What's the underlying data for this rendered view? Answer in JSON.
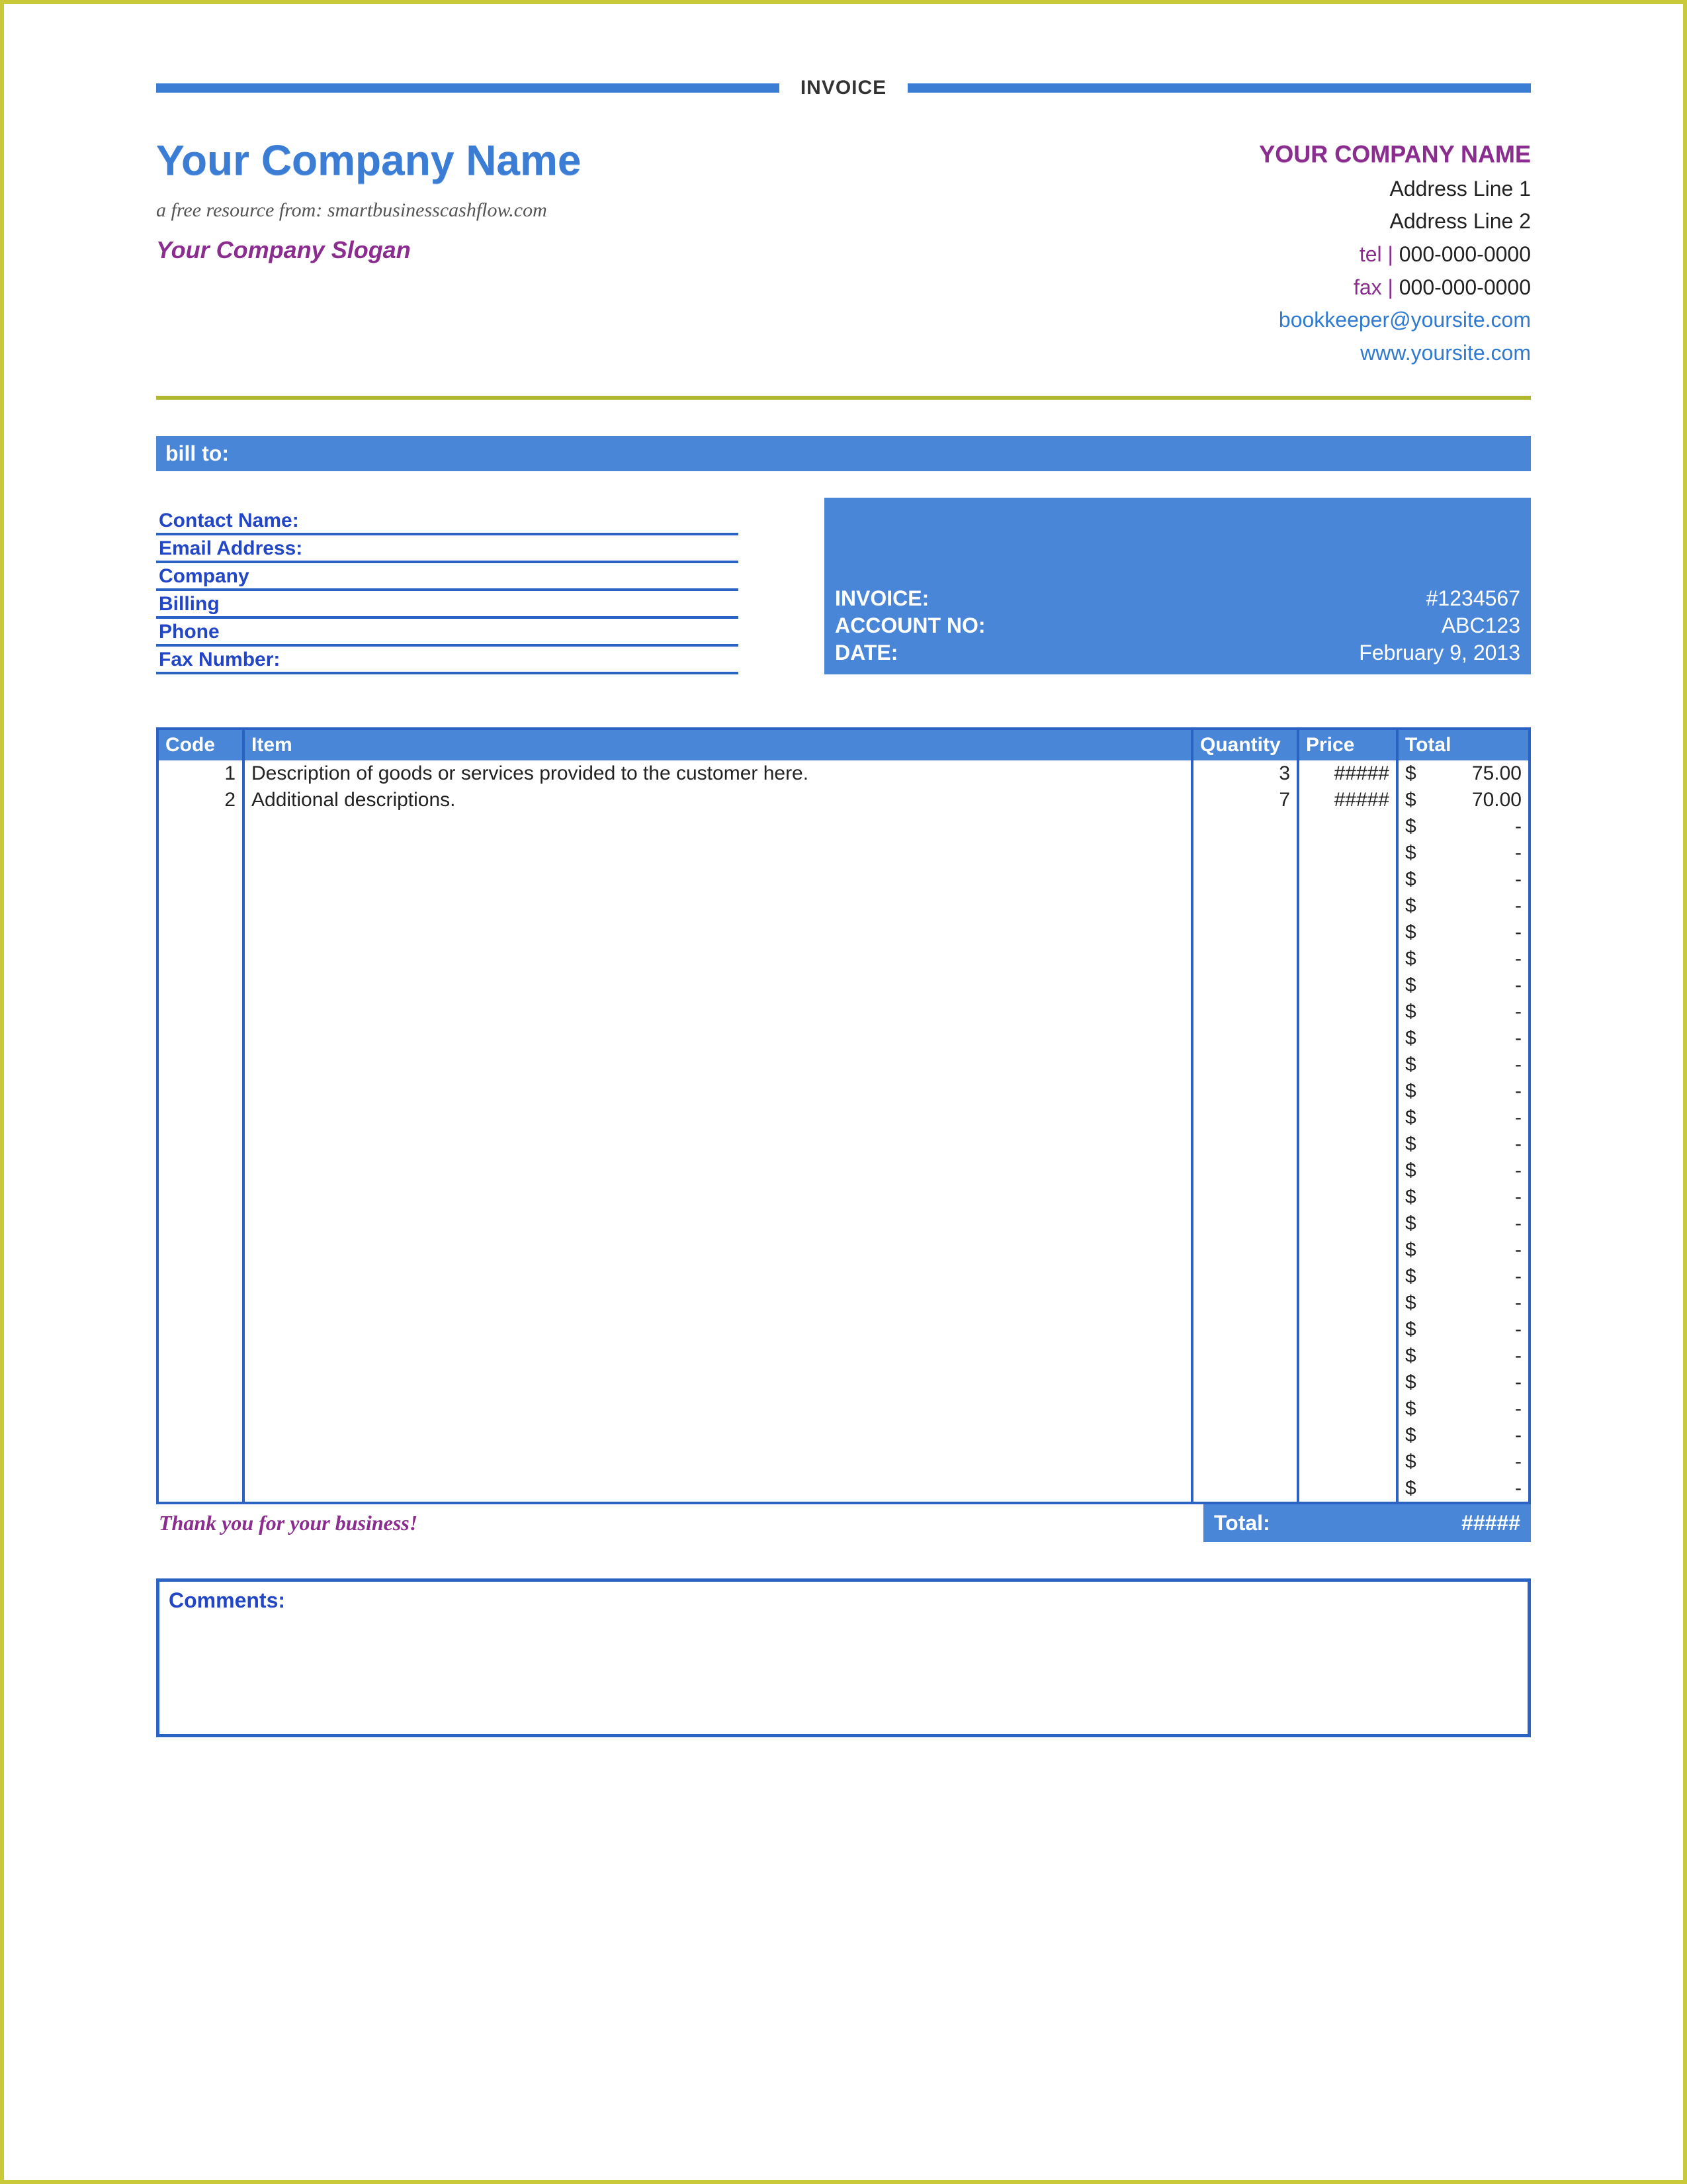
{
  "document": {
    "title": "INVOICE"
  },
  "company": {
    "name": "Your Company Name",
    "resource_line": "a free resource from: smartbusinesscashflow.com",
    "slogan": "Your Company Slogan"
  },
  "vendor": {
    "name": "YOUR COMPANY NAME",
    "address1": "Address Line 1",
    "address2": "Address Line 2",
    "tel_label": "tel |",
    "tel": "000-000-0000",
    "fax_label": "fax |",
    "fax": "000-000-0000",
    "email": "bookkeeper@yoursite.com",
    "website": "www.yoursite.com"
  },
  "billto": {
    "header": "bill to:",
    "fields": {
      "contact": "Contact Name:",
      "email": "Email Address:",
      "company": "Company",
      "billing": "Billing",
      "phone": "Phone",
      "fax": "Fax Number:"
    }
  },
  "meta": {
    "invoice_label": "INVOICE:",
    "invoice_value": "#1234567",
    "account_label": "ACCOUNT NO:",
    "account_value": "ABC123",
    "date_label": "DATE:",
    "date_value": "February 9, 2013"
  },
  "items": {
    "headers": {
      "code": "Code",
      "item": "Item",
      "quantity": "Quantity",
      "price": "Price",
      "total": "Total"
    },
    "rows": [
      {
        "code": "1",
        "item": "Description of goods or services provided to the customer here.",
        "quantity": "3",
        "price": "#####",
        "total": "75.00"
      },
      {
        "code": "2",
        "item": "Additional descriptions.",
        "quantity": "7",
        "price": "#####",
        "total": "70.00"
      }
    ],
    "currency": "$",
    "empty_dash": "-",
    "empty_count": 26
  },
  "footer": {
    "thanks": "Thank you for your business!",
    "total_label": "Total:",
    "total_value": "#####"
  },
  "comments": {
    "label": "Comments:"
  }
}
